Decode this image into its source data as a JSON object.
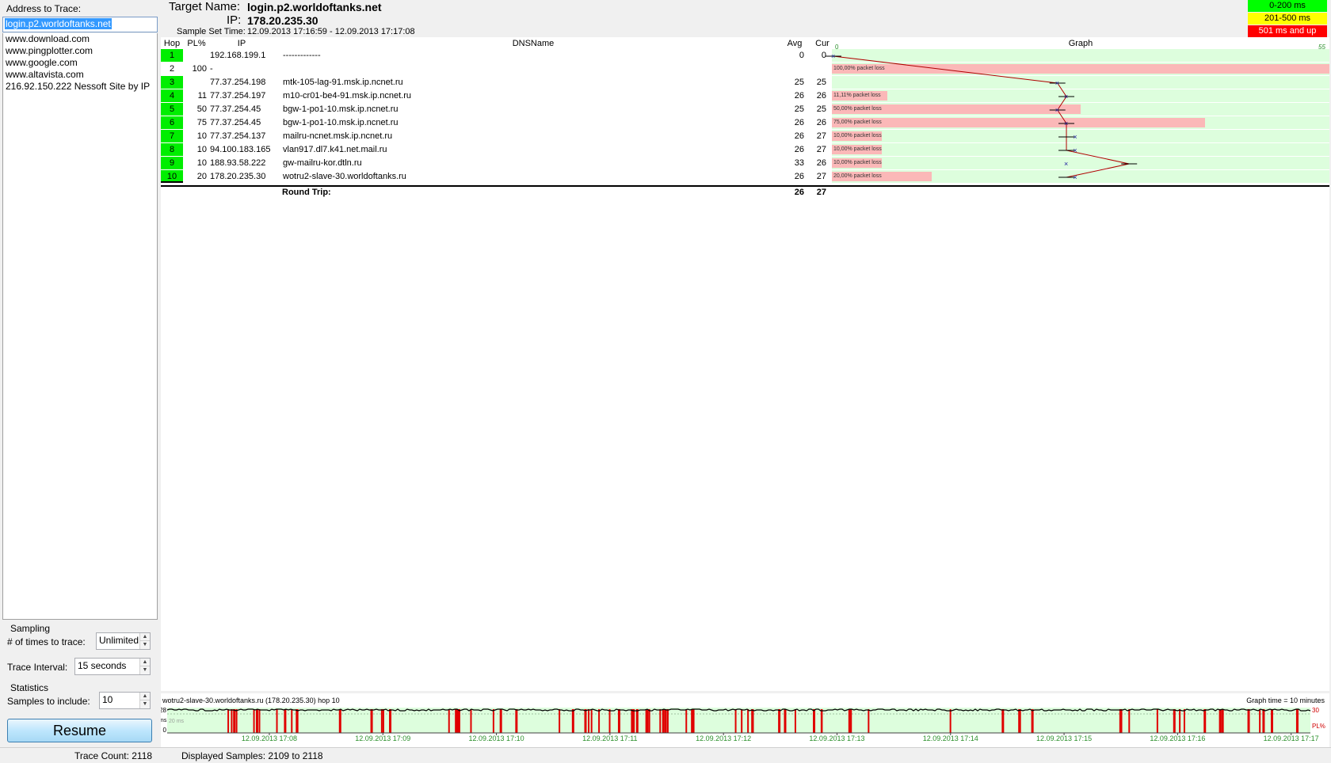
{
  "sidebar": {
    "address_label": "Address to Trace:",
    "address_value": "login.p2.worldoftanks.net",
    "address_history": [
      "www.download.com",
      "www.pingplotter.com",
      "www.google.com",
      "www.altavista.com",
      "216.92.150.222 Nessoft Site by IP"
    ],
    "sampling_title": "Sampling",
    "times_label": "# of times to trace:",
    "times_value": "Unlimited",
    "interval_label": "Trace Interval:",
    "interval_value": "15 seconds",
    "statistics_title": "Statistics",
    "samples_label": "Samples to include:",
    "samples_value": "10",
    "resume_label": "Resume"
  },
  "header": {
    "target_label": "Target Name:",
    "target_name": "login.p2.worldoftanks.net",
    "ip_label": "IP:",
    "ip": "178.20.235.30",
    "sample_time_label": "Sample Set Time:",
    "sample_time": "12.09.2013 17:16:59 - 12.09.2013 17:17:08"
  },
  "legend": [
    {
      "label": "0-200 ms",
      "color": "#00ff00",
      "text_color": "#000000"
    },
    {
      "label": "201-500 ms",
      "color": "#ffff00",
      "text_color": "#000000"
    },
    {
      "label": "501 ms and up",
      "color": "#ff0000",
      "text_color": "#ffffff"
    }
  ],
  "table": {
    "columns": {
      "hop": "Hop",
      "pl": "PL%",
      "ip": "IP",
      "dns": "DNSName",
      "avg": "Avg",
      "cur": "Cur",
      "graph": "Graph"
    },
    "graph_scale_left": "0",
    "graph_scale_right": "55",
    "hop_color": "#00ee00",
    "loss_color": "#fbb8b8",
    "rows": [
      {
        "hop": "1",
        "pl": "",
        "ip": "192.168.199.1",
        "dns": "-------------",
        "avg": "0",
        "cur": "0",
        "loss_label": "",
        "loss_pct": 0,
        "green": true
      },
      {
        "hop": "2",
        "pl": "100",
        "ip": "-",
        "dns": "",
        "avg": "",
        "cur": "",
        "loss_label": "100,00% packet loss",
        "loss_pct": 100,
        "green": false
      },
      {
        "hop": "3",
        "pl": "",
        "ip": "77.37.254.198",
        "dns": "mtk-105-lag-91.msk.ip.ncnet.ru",
        "avg": "25",
        "cur": "25",
        "loss_label": "",
        "loss_pct": 0,
        "green": true
      },
      {
        "hop": "4",
        "pl": "11",
        "ip": "77.37.254.197",
        "dns": "m10-cr01-be4-91.msk.ip.ncnet.ru",
        "avg": "26",
        "cur": "26",
        "loss_label": "11,11% packet loss",
        "loss_pct": 11.11,
        "green": true
      },
      {
        "hop": "5",
        "pl": "50",
        "ip": "77.37.254.45",
        "dns": "bgw-1-po1-10.msk.ip.ncnet.ru",
        "avg": "25",
        "cur": "25",
        "loss_label": "50,00% packet loss",
        "loss_pct": 50,
        "green": true
      },
      {
        "hop": "6",
        "pl": "75",
        "ip": "77.37.254.45",
        "dns": "bgw-1-po1-10.msk.ip.ncnet.ru",
        "avg": "26",
        "cur": "26",
        "loss_label": "75,00% packet loss",
        "loss_pct": 75,
        "green": true
      },
      {
        "hop": "7",
        "pl": "10",
        "ip": "77.37.254.137",
        "dns": "mailru-ncnet.msk.ip.ncnet.ru",
        "avg": "26",
        "cur": "27",
        "loss_label": "10,00% packet loss",
        "loss_pct": 10,
        "green": true
      },
      {
        "hop": "8",
        "pl": "10",
        "ip": "94.100.183.165",
        "dns": "vlan917.dl7.k41.net.mail.ru",
        "avg": "26",
        "cur": "27",
        "loss_label": "10,00% packet loss",
        "loss_pct": 10,
        "green": true
      },
      {
        "hop": "9",
        "pl": "10",
        "ip": "188.93.58.222",
        "dns": "gw-mailru-kor.dtln.ru",
        "avg": "33",
        "cur": "26",
        "loss_label": "10,00% packet loss",
        "loss_pct": 10,
        "green": true
      },
      {
        "hop": "10",
        "pl": "20",
        "ip": "178.20.235.30",
        "dns": "wotru2-slave-30.worldoftanks.ru",
        "avg": "26",
        "cur": "27",
        "loss_label": "20,00% packet loss",
        "loss_pct": 20,
        "green": true
      }
    ],
    "round_trip_label": "Round Trip:",
    "round_trip_avg": "26",
    "round_trip_cur": "27"
  },
  "bottom_graph": {
    "title": "wotru2-slave-30.worldoftanks.ru (178.20.235.30) hop 10",
    "graph_time": "Graph time = 10 minutes",
    "y_top": "28",
    "y_bottom": "0",
    "y_unit": "ms",
    "ref_label": "20 ms",
    "pl_unit": "PL%",
    "pl_max": "30",
    "time_labels": [
      "12.09.2013 17:08",
      "12.09.2013 17:09",
      "12.09.2013 17:10",
      "12.09.2013 17:11",
      "12.09.2013 17:12",
      "12.09.2013 17:13",
      "12.09.2013 17:14",
      "12.09.2013 17:15",
      "12.09.2013 17:16",
      "12.09.2013 17:17"
    ]
  },
  "status": {
    "trace_count": "Trace Count: 2118",
    "displayed_samples": "Displayed Samples: 2109 to 2118"
  }
}
